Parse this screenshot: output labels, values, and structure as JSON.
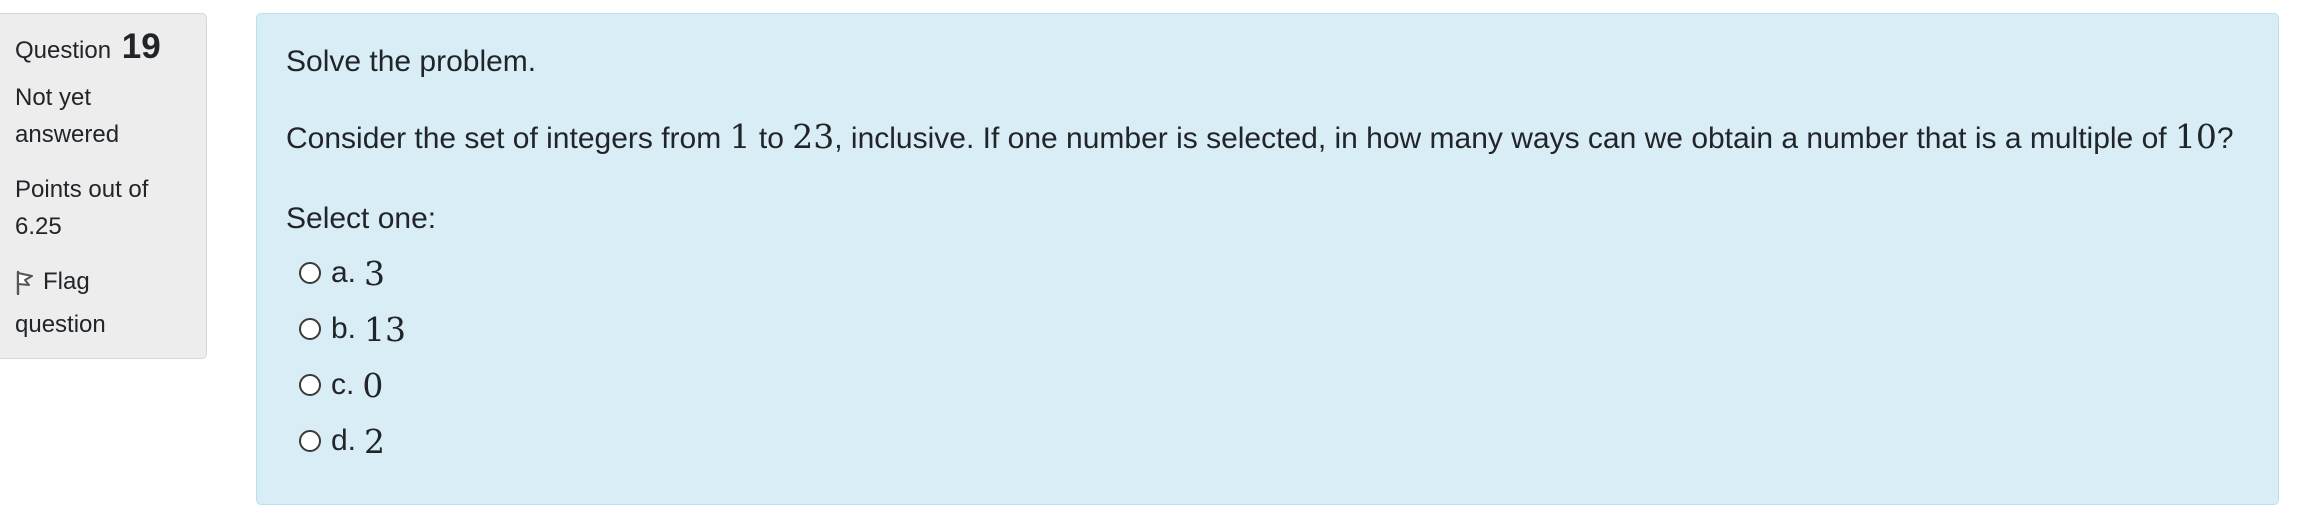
{
  "info": {
    "question_label": "Question",
    "question_number": "19",
    "state_line1": "Not yet",
    "state_line2": "answered",
    "grade_line1": "Points out of",
    "grade_line2": "6.25",
    "flag_line1": "Flag",
    "flag_line2": "question",
    "flag_icon": "flag-icon"
  },
  "question": {
    "intro": "Solve the problem.",
    "text_part1": "Consider the set of integers from ",
    "math1": "1",
    "text_part2": " to ",
    "math2": "23",
    "text_part3": ", inclusive. If one number is selected, in how many ways can we obtain a number that is a multiple of ",
    "math3": "10",
    "text_part4": "?",
    "prompt": "Select one:"
  },
  "answers": [
    {
      "letter": "a.",
      "value": "3"
    },
    {
      "letter": "b.",
      "value": "13"
    },
    {
      "letter": "c.",
      "value": "0"
    },
    {
      "letter": "d.",
      "value": "2"
    }
  ],
  "colors": {
    "content_bg": "#d9edf6",
    "content_border": "#b8e1ef",
    "info_bg": "#ededed"
  }
}
